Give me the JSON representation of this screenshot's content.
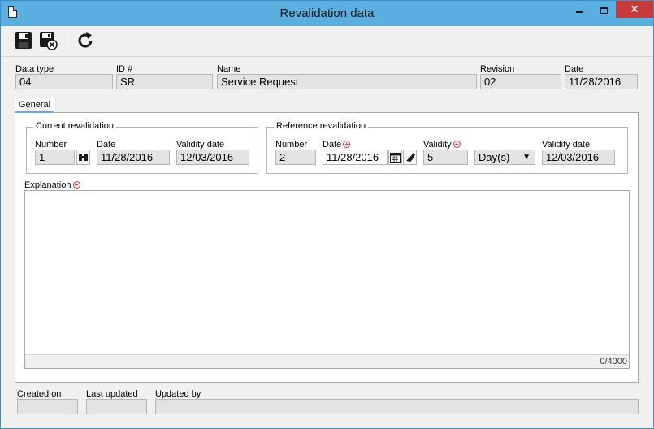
{
  "window": {
    "title": "Revalidation data",
    "close_glyph": "✕"
  },
  "toolbar": {
    "save_icon": "save-icon",
    "save_close_icon": "save-and-close-icon",
    "refresh_icon": "refresh-icon"
  },
  "header": {
    "data_type": {
      "label": "Data type",
      "value": "04"
    },
    "id": {
      "label": "ID #",
      "value": "SR"
    },
    "name": {
      "label": "Name",
      "value": "Service Request"
    },
    "revision": {
      "label": "Revision",
      "value": "02"
    },
    "date": {
      "label": "Date",
      "value": "11/28/2016"
    }
  },
  "tabs": [
    {
      "label": "General",
      "active": true
    }
  ],
  "current_revalidation": {
    "title": "Current revalidation",
    "number": {
      "label": "Number",
      "value": "1"
    },
    "date": {
      "label": "Date",
      "value": "11/28/2016"
    },
    "validity_date": {
      "label": "Validity date",
      "value": "12/03/2016"
    }
  },
  "reference_revalidation": {
    "title": "Reference revalidation",
    "number": {
      "label": "Number",
      "value": "2"
    },
    "date": {
      "label": "Date",
      "value": "11/28/2016"
    },
    "validity": {
      "label": "Validity",
      "value": "5"
    },
    "unit": {
      "value": "Day(s)",
      "arrow": "▼"
    },
    "validity_date": {
      "label": "Validity date",
      "value": "12/03/2016"
    }
  },
  "explanation": {
    "label": "Explanation",
    "value": "",
    "counter": "0/4000"
  },
  "footer": {
    "created_on": {
      "label": "Created on",
      "value": ""
    },
    "last_updated": {
      "label": "Last updated",
      "value": ""
    },
    "updated_by": {
      "label": "Updated by",
      "value": ""
    }
  },
  "colors": {
    "titlebar": "#5aaee0",
    "close": "#c73a3a",
    "required": "#dd3333",
    "field_readonly": "#e3e3e3"
  }
}
